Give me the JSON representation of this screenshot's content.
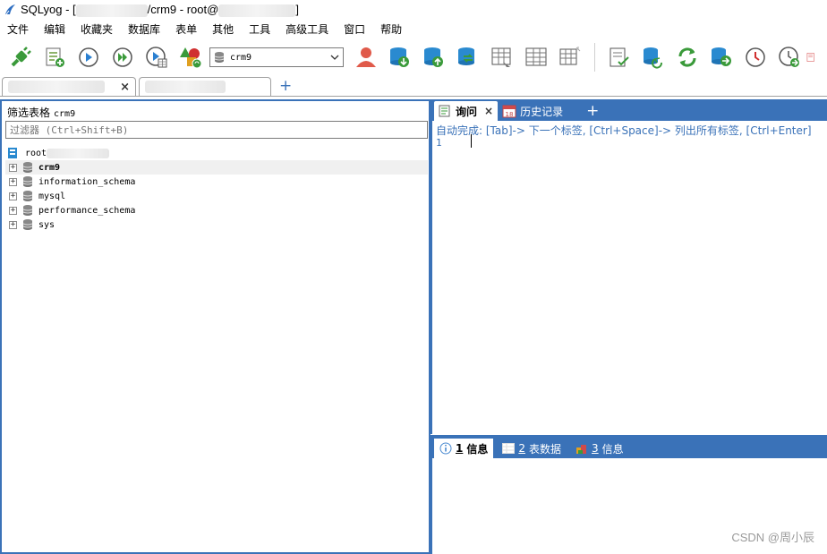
{
  "window": {
    "title_prefix": "SQLyog - [",
    "title_mid": "/crm9 - root@",
    "title_suffix": "]"
  },
  "menu": {
    "items": [
      "文件",
      "编辑",
      "收藏夹",
      "数据库",
      "表单",
      "其他",
      "工具",
      "高级工具",
      "窗口",
      "帮助"
    ]
  },
  "toolbar": {
    "db_selected": "crm9",
    "icons": [
      "new-connection-icon",
      "new-query-icon",
      "execute-query-icon",
      "execute-all-icon",
      "execute-to-file-icon",
      "schema-designer-icon",
      "backup-icon",
      "restore-icon",
      "sync-icon",
      "import-icon",
      "table-data-icon",
      "grid-view-icon",
      "check-icon",
      "copy-db-icon",
      "refresh-icon",
      "migrate-icon",
      "scheduler-icon",
      "job-icon"
    ]
  },
  "conn_tabs": {
    "close": "×",
    "add": "+"
  },
  "left": {
    "filter_label": "筛选表格",
    "filter_db": "crm9",
    "filter_placeholder": "过滤器 (Ctrl+Shift+B)",
    "root_label": "root",
    "databases": [
      {
        "name": "crm9",
        "bold": true
      },
      {
        "name": "information_schema",
        "bold": false
      },
      {
        "name": "mysql",
        "bold": false
      },
      {
        "name": "performance_schema",
        "bold": false
      },
      {
        "name": "sys",
        "bold": false
      }
    ]
  },
  "right": {
    "query_tab": "询问",
    "query_tab_close": "×",
    "history_tab": "历史记录",
    "add_tab": "+",
    "autocomplete": "自动完成: [Tab]-> 下一个标签, [Ctrl+Space]-> 列出所有标签, [Ctrl+Enter]",
    "line_number": "1",
    "result_tabs": [
      {
        "num": "1",
        "label": "信息"
      },
      {
        "num": "2",
        "label": "表数据"
      },
      {
        "num": "3",
        "label": "信息"
      }
    ]
  },
  "watermark": "CSDN @周小辰",
  "colors": {
    "accent": "#3a72b8"
  }
}
